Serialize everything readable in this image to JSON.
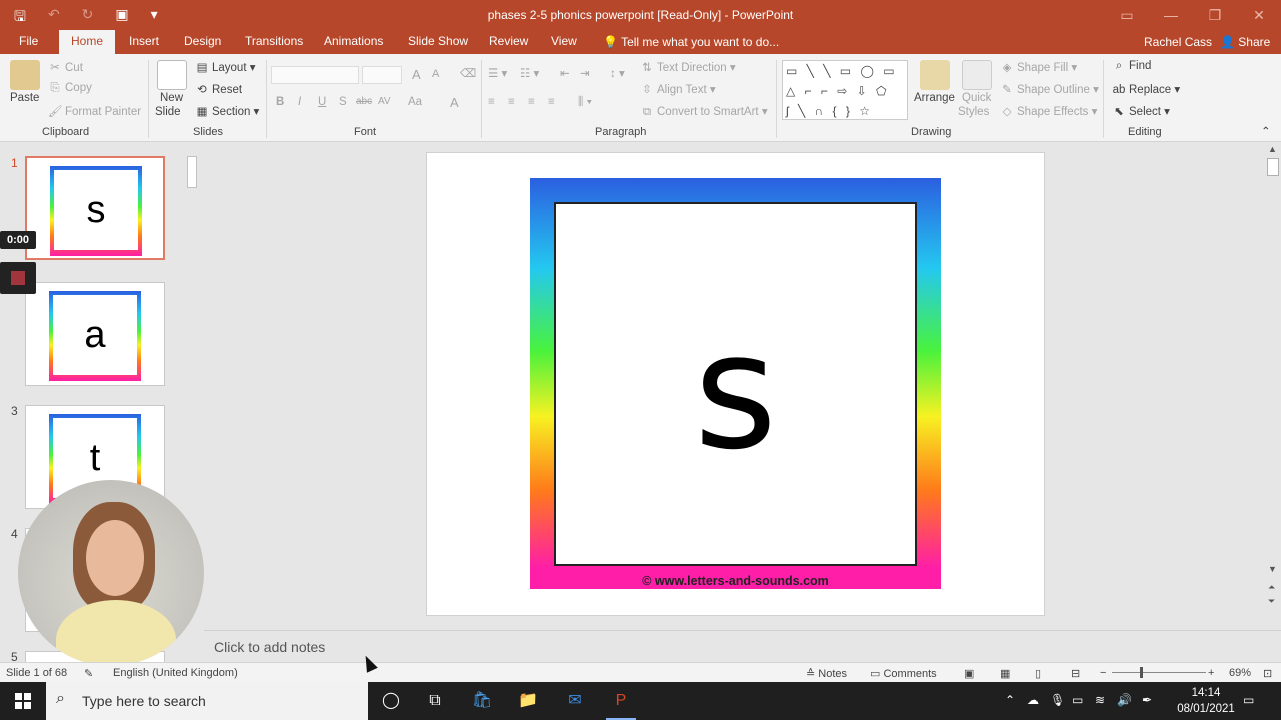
{
  "window": {
    "title": "phases 2-5 phonics powerpoint [Read-Only] - PowerPoint",
    "qat": {
      "save_icon": "save-icon",
      "undo_icon": "undo-icon",
      "redo_icon": "redo-icon",
      "present_icon": "present-from-start-icon",
      "customize": "▾"
    },
    "controls": {
      "ribbon_display": "▭",
      "minimize": "—",
      "restore": "❐",
      "close": "✕"
    }
  },
  "tabs": [
    "File",
    "Home",
    "Insert",
    "Design",
    "Transitions",
    "Animations",
    "Slide Show",
    "Review",
    "View"
  ],
  "active_tab": "Home",
  "tell_me": "Tell me what you want to do...",
  "user": "Rachel Cass",
  "share": "Share",
  "ribbon": {
    "clipboard": {
      "paste": "Paste",
      "cut": "Cut",
      "copy": "Copy",
      "format_painter": "Format Painter",
      "label": "Clipboard"
    },
    "slides": {
      "new_slide": "New",
      "new_slide2": "Slide",
      "layout": "Layout",
      "reset": "Reset",
      "section": "Section",
      "label": "Slides"
    },
    "font": {
      "bold": "B",
      "italic": "I",
      "underline": "U",
      "shadow": "S",
      "strike": "abc",
      "spacing": "AV",
      "case": "Aa",
      "color": "A",
      "grow": "A",
      "shrink": "A",
      "label": "Font"
    },
    "paragraph": {
      "text_direction": "Text Direction",
      "align_text": "Align Text",
      "smartart": "Convert to SmartArt",
      "label": "Paragraph"
    },
    "drawing": {
      "arrange": "Arrange",
      "quick": "Quick",
      "styles": "Styles",
      "shape_fill": "Shape Fill",
      "shape_outline": "Shape Outline",
      "shape_effects": "Shape Effects",
      "label": "Drawing"
    },
    "editing": {
      "find": "Find",
      "replace": "Replace",
      "select": "Select",
      "label": "Editing"
    }
  },
  "thumbnails": [
    {
      "num": "1",
      "letter": "s",
      "selected": true
    },
    {
      "num": "",
      "letter": "a",
      "selected": false
    },
    {
      "num": "3",
      "letter": "t",
      "selected": false
    },
    {
      "num": "4",
      "letter": "",
      "selected": false
    },
    {
      "num": "5",
      "letter": "",
      "selected": false
    }
  ],
  "recording": {
    "timer": "0:00"
  },
  "slide": {
    "letter": "s",
    "footer": "© www.letters-and-sounds.com"
  },
  "notes_placeholder": "Click to add notes",
  "status": {
    "slide_counter": "Slide 1 of 68",
    "language": "English (United Kingdom)",
    "notes": "Notes",
    "comments": "Comments",
    "zoom": "69%"
  },
  "taskbar": {
    "search_placeholder": "Type here to search",
    "time": "14:14",
    "date": "08/01/2021"
  },
  "colors": {
    "accent": "#b7472a",
    "selected_thumb": "#d24726"
  }
}
